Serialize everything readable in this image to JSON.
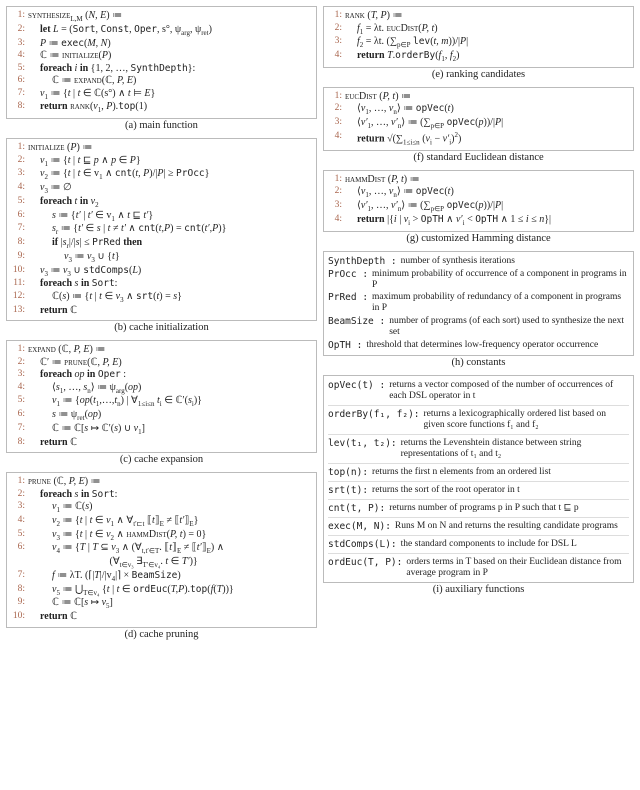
{
  "captions": {
    "a": "(a) main function",
    "b": "(b) cache initialization",
    "c": "(c) cache expansion",
    "d": "(d) cache pruning",
    "e": "(e) ranking candidates",
    "f": "(f) standard Euclidean distance",
    "g": "(g) customized Hamming distance",
    "h": "(h) constants",
    "i": "(i) auxiliary functions"
  },
  "constants": [
    {
      "k": "SynthDepth :",
      "v": "number of synthesis iterations"
    },
    {
      "k": "PrOcc :",
      "v": "minimum probability of occurrence of a component in programs in P"
    },
    {
      "k": "PrRed :",
      "v": "maximum probability of redundancy of a component in programs in P"
    },
    {
      "k": "BeamSize :",
      "v": "number of programs (of each sort) used to synthesize the next set"
    },
    {
      "k": "OpTH :",
      "v": "threshold that determines low-frequency operator occurrence"
    }
  ],
  "aux": [
    {
      "k": "opVec(t) :",
      "v": "returns a vector composed of the number of occurrences of each DSL operator in t"
    },
    {
      "k": "orderBy(f₁, f₂):",
      "v": "returns a lexicographically ordered list based on given score functions f₁ and f₂"
    },
    {
      "k": "lev(t₁, t₂):",
      "v": "returns the Levenshtein distance between string representations of t₁ and t₂"
    },
    {
      "k": "top(n):",
      "v": "returns the first n elements from an ordered list"
    },
    {
      "k": "srt(t):",
      "v": "returns the sort of the root operator in t"
    },
    {
      "k": "cnt(t, P):",
      "v": "returns number of programs p in P such that t ⊑ p"
    },
    {
      "k": "exec(M, N):",
      "v": "Runs M on N and returns the resulting candidate programs"
    },
    {
      "k": "stdComps(L):",
      "v": "the standard components to include for DSL L"
    },
    {
      "k": "ordEuc(T, P):",
      "v": "orders terms in T based on their Euclidean distance from average program in P"
    }
  ]
}
